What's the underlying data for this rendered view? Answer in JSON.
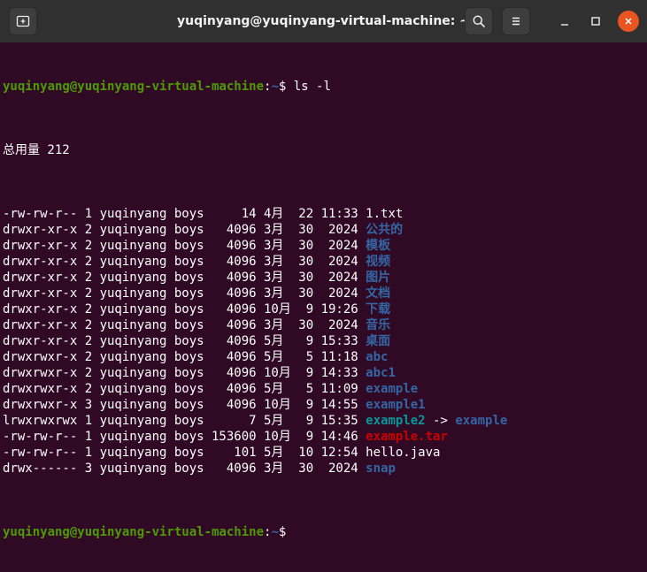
{
  "window": {
    "title": "yuqinyang@yuqinyang-virtual-machine: ~"
  },
  "colors": {
    "dir": "#3465a4",
    "link": "#06989a",
    "archive": "#cc0000",
    "prompt": "#4e9a06",
    "background": "#300a24",
    "close": "#e95420"
  },
  "icons": {
    "new_tab": "new-tab-icon",
    "search": "search-icon",
    "menu": "hamburger-menu-icon",
    "minimize": "minimize-icon",
    "maximize": "maximize-icon",
    "close": "close-icon"
  },
  "prompt": {
    "user_host": "yuqinyang@yuqinyang-virtual-machine",
    "sep": ":",
    "path": "~",
    "dollar": "$"
  },
  "command": " ls -l",
  "total": "总用量 212",
  "entries": [
    {
      "meta": "-rw-rw-r-- 1 yuqinyang boys     14 4月  22 11:33 ",
      "name": "1.txt",
      "type": "plain"
    },
    {
      "meta": "drwxr-xr-x 2 yuqinyang boys   4096 3月  30  2024 ",
      "name": "公共的",
      "type": "dir"
    },
    {
      "meta": "drwxr-xr-x 2 yuqinyang boys   4096 3月  30  2024 ",
      "name": "模板",
      "type": "dir"
    },
    {
      "meta": "drwxr-xr-x 2 yuqinyang boys   4096 3月  30  2024 ",
      "name": "视频",
      "type": "dir"
    },
    {
      "meta": "drwxr-xr-x 2 yuqinyang boys   4096 3月  30  2024 ",
      "name": "图片",
      "type": "dir"
    },
    {
      "meta": "drwxr-xr-x 2 yuqinyang boys   4096 3月  30  2024 ",
      "name": "文档",
      "type": "dir"
    },
    {
      "meta": "drwxr-xr-x 2 yuqinyang boys   4096 10月  9 19:26 ",
      "name": "下载",
      "type": "dir"
    },
    {
      "meta": "drwxr-xr-x 2 yuqinyang boys   4096 3月  30  2024 ",
      "name": "音乐",
      "type": "dir"
    },
    {
      "meta": "drwxr-xr-x 2 yuqinyang boys   4096 5月   9 15:33 ",
      "name": "桌面",
      "type": "dir"
    },
    {
      "meta": "drwxrwxr-x 2 yuqinyang boys   4096 5月   5 11:18 ",
      "name": "abc",
      "type": "dir"
    },
    {
      "meta": "drwxrwxr-x 2 yuqinyang boys   4096 10月  9 14:33 ",
      "name": "abc1",
      "type": "dir"
    },
    {
      "meta": "drwxrwxr-x 2 yuqinyang boys   4096 5月   5 11:09 ",
      "name": "example",
      "type": "dir"
    },
    {
      "meta": "drwxrwxr-x 3 yuqinyang boys   4096 10月  9 14:55 ",
      "name": "example1",
      "type": "dir"
    },
    {
      "meta": "lrwxrwxrwx 1 yuqinyang boys      7 5月   9 15:35 ",
      "name": "example2",
      "type": "link",
      "arrow": " -> ",
      "target": "example"
    },
    {
      "meta": "-rw-rw-r-- 1 yuqinyang boys 153600 10月  9 14:46 ",
      "name": "example.tar",
      "type": "archive"
    },
    {
      "meta": "-rw-rw-r-- 1 yuqinyang boys    101 5月  10 12:54 ",
      "name": "hello.java",
      "type": "plain"
    },
    {
      "meta": "drwx------ 3 yuqinyang boys   4096 3月  30  2024 ",
      "name": "snap",
      "type": "dir"
    }
  ]
}
